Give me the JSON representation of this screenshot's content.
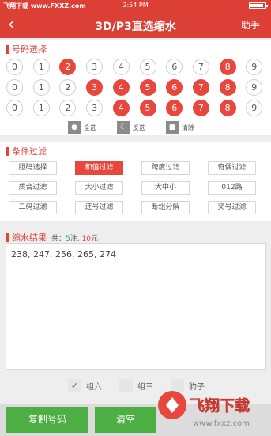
{
  "status_bar": {
    "watermark": "飞翔下载 www.FXXZ.com",
    "time": "2:54 PM"
  },
  "nav": {
    "back_icon": "chevron-left-icon",
    "title": "3D/P3直选缩水",
    "help_label": "助手"
  },
  "number_select": {
    "heading": "号码选择",
    "rows": [
      {
        "balls": [
          "0",
          "1",
          "2",
          "3",
          "4",
          "5",
          "6",
          "7",
          "8",
          "9"
        ],
        "selected": [
          2,
          8
        ]
      },
      {
        "balls": [
          "0",
          "1",
          "2",
          "3",
          "4",
          "5",
          "6",
          "7",
          "8",
          "9"
        ],
        "selected": [
          3,
          4,
          5,
          6,
          7,
          8
        ]
      },
      {
        "balls": [
          "0",
          "1",
          "2",
          "3",
          "4",
          "5",
          "6",
          "7",
          "8",
          "9"
        ],
        "selected": [
          4,
          5,
          6,
          7,
          8
        ]
      }
    ],
    "controls": {
      "select_all": "全选",
      "invert": "反选",
      "clear": "清除"
    }
  },
  "filters": {
    "heading": "条件过滤",
    "buttons": [
      {
        "label": "胆码选择",
        "active": false
      },
      {
        "label": "和值过滤",
        "active": true
      },
      {
        "label": "跨度过滤",
        "active": false
      },
      {
        "label": "奇偶过滤",
        "active": false
      },
      {
        "label": "质合过滤",
        "active": false
      },
      {
        "label": "大小过滤",
        "active": false
      },
      {
        "label": "大中小",
        "active": false
      },
      {
        "label": "012路",
        "active": false
      },
      {
        "label": "二码过滤",
        "active": false
      },
      {
        "label": "连号过滤",
        "active": false
      },
      {
        "label": "断组分解",
        "active": false
      },
      {
        "label": "奖号过滤",
        "active": false
      }
    ]
  },
  "result": {
    "heading": "缩水结果",
    "total_prefix": "共：",
    "notes": "5",
    "notes_unit": "注,",
    "amount": "10",
    "amount_unit": "元",
    "text": "238, 247, 256, 265, 274"
  },
  "options": {
    "group6": "组六",
    "group3": "组三",
    "leopard": "豹子"
  },
  "bottom": {
    "copy_label": "复制号码",
    "clear_label": "清空"
  },
  "watermark_logo": "飞翔下载 www.fxxz.com",
  "colors": {
    "primary": "#dc3f36",
    "ball_selected": "#e8473d",
    "button_green": "#4cae43"
  }
}
